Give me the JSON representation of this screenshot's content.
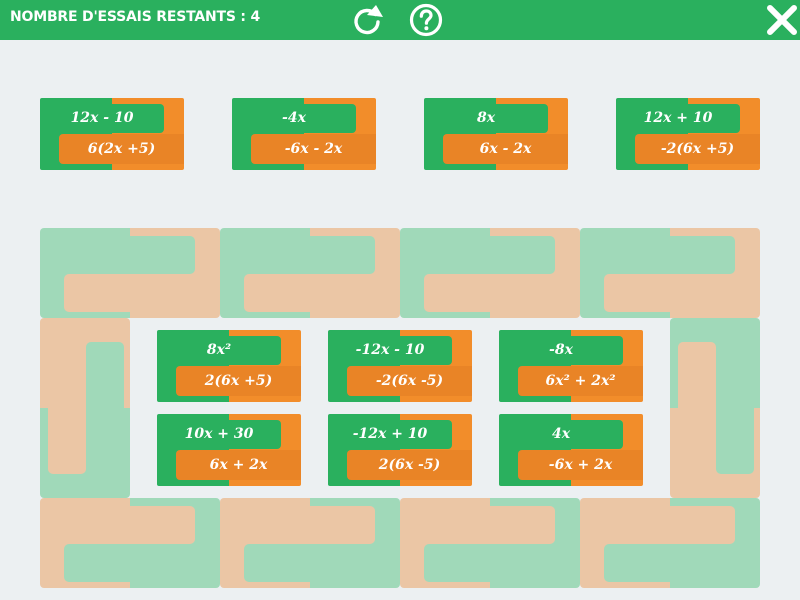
{
  "header": {
    "trials_label": "NOMBRE D'ESSAIS RESTANTS  : 4",
    "icons": {
      "restart": "restart-icon",
      "help": "help-icon",
      "close": "close-icon"
    }
  },
  "colors": {
    "top_bar": "#2ab05e",
    "card_green": "#2ab05e",
    "card_orange": "#f28d2a",
    "slot_green": "#a0d9b9",
    "slot_orange": "#ebc6a5",
    "background": "#ecf0f2"
  },
  "top_cards": [
    {
      "top": "12x - 10",
      "bottom": "6(2x +5)"
    },
    {
      "top": "-4x",
      "bottom": "-6x - 2x"
    },
    {
      "top": "8x",
      "bottom": "6x - 2x"
    },
    {
      "top": "12x + 10",
      "bottom": "-2(6x +5)"
    }
  ],
  "center_cards": [
    {
      "top": "8x²",
      "bottom": "2(6x +5)"
    },
    {
      "top": "-12x - 10",
      "bottom": "-2(6x -5)"
    },
    {
      "top": "-8x",
      "bottom": "6x² + 2x²"
    },
    {
      "top": "10x + 30",
      "bottom": "6x + 2x"
    },
    {
      "top": "-12x + 10",
      "bottom": "2(6x -5)"
    },
    {
      "top": "4x",
      "bottom": "-6x + 2x"
    }
  ]
}
